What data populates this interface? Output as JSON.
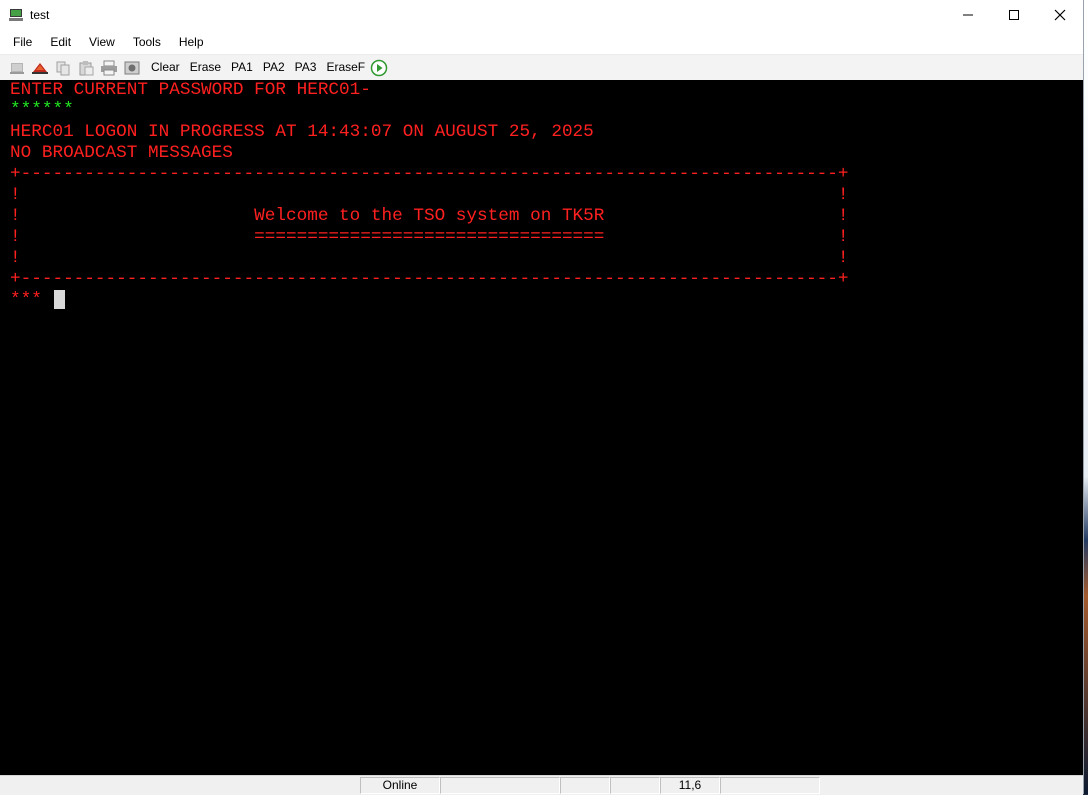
{
  "window": {
    "title": "test",
    "controls": [
      "minimize",
      "maximize",
      "close"
    ]
  },
  "menubar": {
    "items": [
      "File",
      "Edit",
      "View",
      "Tools",
      "Help"
    ]
  },
  "toolbar": {
    "icons": [
      "disconnect-icon",
      "connect-icon",
      "copy-icon",
      "paste-icon",
      "print-icon",
      "screenshot-icon"
    ],
    "clear": "Clear",
    "erase": "Erase",
    "pa1": "PA1",
    "pa2": "PA2",
    "pa3": "PA3",
    "erasef": "EraseF",
    "run_icon": "play-icon"
  },
  "terminal": {
    "line1": "ENTER CURRENT PASSWORD FOR HERC01-",
    "line2": "******",
    "line4": "HERC01 LOGON IN PROGRESS AT 14:43:07 ON AUGUST 25, 2025",
    "line5": "NO BROADCAST MESSAGES",
    "line6": "+-----------------------------------------------------------------------------+",
    "line7": "!                                                                             !",
    "line8": "!                      Welcome to the TSO system on TK5R                      !",
    "line9": "!                      =================================                      !",
    "line10": "!                                                                             !",
    "line11": "+-----------------------------------------------------------------------------+",
    "line12": "***",
    "colors": {
      "text": "#ff2020",
      "password_mask": "#22e622",
      "background": "#000000"
    }
  },
  "statusbar": {
    "connection": "Online",
    "cursor_pos": "11,6"
  }
}
